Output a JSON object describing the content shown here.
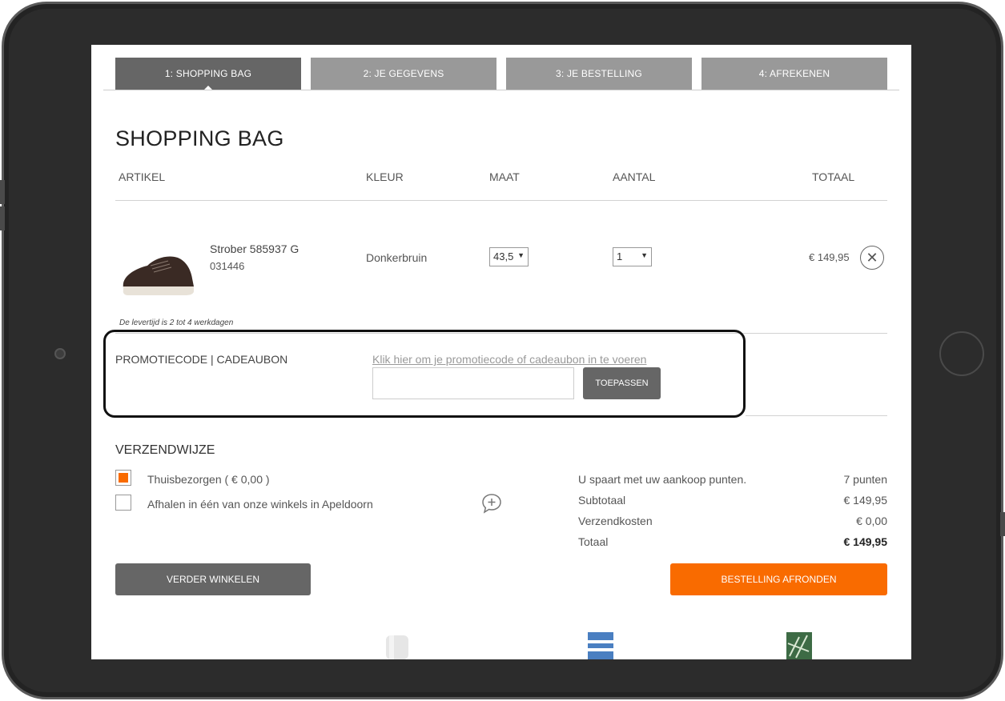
{
  "steps": [
    {
      "label": "1: SHOPPING BAG"
    },
    {
      "label": "2: JE GEGEVENS"
    },
    {
      "label": "3: JE BESTELLING"
    },
    {
      "label": "4: AFREKENEN"
    }
  ],
  "page_title": "SHOPPING BAG",
  "table": {
    "headers": {
      "artikel": "ARTIKEL",
      "kleur": "KLEUR",
      "maat": "MAAT",
      "aantal": "AANTAL",
      "totaal": "TOTAAL"
    }
  },
  "item": {
    "name": "Strober 585937 G",
    "code": "031446",
    "color": "Donkerbruin",
    "size": "43,5",
    "quantity": "1",
    "price": "€ 149,95",
    "delivery_note": "De levertijd is 2 tot 4 werkdagen"
  },
  "promo": {
    "label": "PROMOTIECODE | CADEAUBON",
    "link": "Klik hier om je promotiecode of cadeaubon in te voeren",
    "input_value": "",
    "button": "TOEPASSEN"
  },
  "shipping": {
    "title": "VERZENDWIJZE",
    "options": [
      {
        "label": "Thuisbezorgen ( € 0,00 )",
        "checked": true
      },
      {
        "label": "Afhalen in één van onze winkels in Apeldoorn",
        "checked": false
      }
    ]
  },
  "summary": {
    "points_label": "U spaart met uw aankoop punten.",
    "points_value": "7 punten",
    "subtotal_label": "Subtotaal",
    "subtotal_value": "€ 149,95",
    "shipping_label": "Verzendkosten",
    "shipping_value": "€ 0,00",
    "total_label": "Totaal",
    "total_value": "€ 149,95"
  },
  "buttons": {
    "continue": "VERDER WINKELEN",
    "order": "BESTELLING AFRONDEN"
  },
  "colors": {
    "accent": "#f96b00",
    "step_active": "#666666",
    "step_inactive": "#999999"
  }
}
